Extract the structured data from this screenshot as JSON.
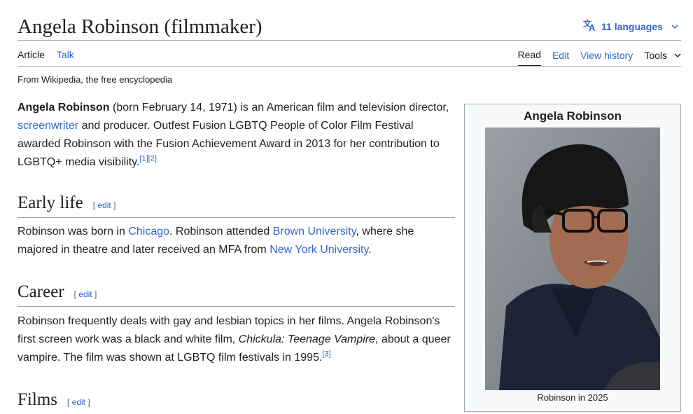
{
  "page": {
    "title": "Angela Robinson (filmmaker)",
    "languages_label": "11 languages",
    "tagline": "From Wikipedia, the free encyclopedia"
  },
  "tabs": {
    "article": "Article",
    "talk": "Talk",
    "read": "Read",
    "edit": "Edit",
    "view_history": "View history",
    "tools": "Tools"
  },
  "intro": {
    "name": "Angela Robinson",
    "t1": " (born February 14, 1971) is an American film and television director, ",
    "link_screenwriter": "screenwriter",
    "t2": " and producer. Outfest Fusion LGBTQ People of Color Film Festival awarded Robinson with the Fusion Achievement Award in 2013 for her contribution to LGBTQ+ media visibility.",
    "ref1": "[1]",
    "ref2": "[2]"
  },
  "sections": {
    "edit_open": "[ ",
    "edit_label": "edit",
    "edit_close": " ]",
    "early_life": {
      "heading": "Early life",
      "t1": "Robinson was born in ",
      "link_chicago": "Chicago",
      "t2": ". Robinson attended ",
      "link_brown": "Brown University",
      "t3": ", where she majored in theatre and later received an MFA from ",
      "link_nyu": "New York University",
      "t4": "."
    },
    "career": {
      "heading": "Career",
      "t1": "Robinson frequently deals with gay and lesbian topics in her films. Angela Robinson's first screen work was a black and white film, ",
      "film_title": "Chickula: Teenage Vampire",
      "t2": ", about a queer vampire. The film was shown at LGBTQ film festivals in 1995.",
      "ref3": "[3]"
    },
    "films": {
      "heading": "Films"
    }
  },
  "infobox": {
    "title": "Angela Robinson",
    "caption": "Robinson in 2025"
  },
  "colors": {
    "link": "#3366cc",
    "text": "#202122",
    "rule": "#a2a9b1",
    "infobox_bg": "#f8f9fa"
  }
}
